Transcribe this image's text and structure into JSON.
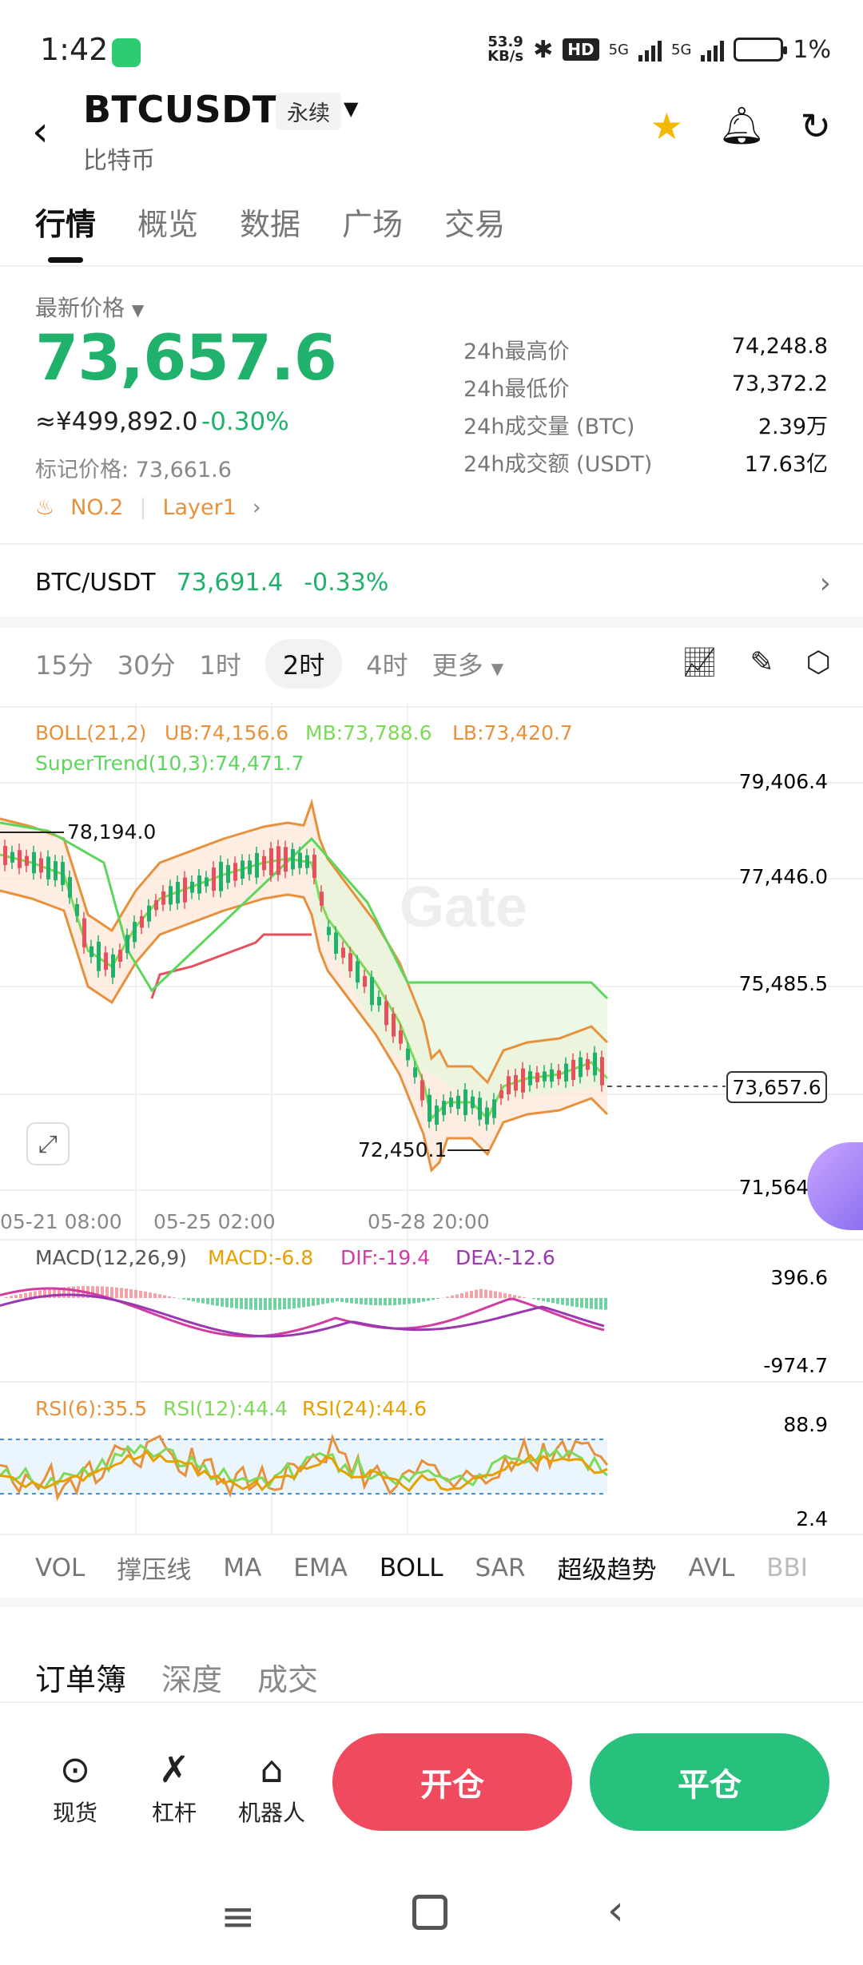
{
  "status": {
    "time": "1:42",
    "net_speed_top": "53.9",
    "net_speed_bottom": "KB/s",
    "hd": "HD",
    "net1": "5G",
    "net2": "5G",
    "battery": "1%"
  },
  "header": {
    "symbol": "BTCUSDT",
    "contract_type": "永续",
    "subtitle": "比特币"
  },
  "tabs": [
    "行情",
    "概览",
    "数据",
    "广场",
    "交易"
  ],
  "price": {
    "label": "最新价格",
    "last": "73,657.6",
    "cny": "≈¥499,892.0",
    "change": "-0.30%",
    "mark": "标记价格: 73,661.6",
    "rank": "NO.2",
    "category": "Layer1"
  },
  "stats": [
    {
      "k": "24h最高价",
      "v": "74,248.8"
    },
    {
      "k": "24h最低价",
      "v": "73,372.2"
    },
    {
      "k": "24h成交量 (BTC)",
      "v": "2.39万"
    },
    {
      "k": "24h成交额 (USDT)",
      "v": "17.63亿"
    }
  ],
  "spot_pair": {
    "name": "BTC/USDT",
    "price": "73,691.4",
    "change": "-0.33%"
  },
  "timeframes": [
    "15分",
    "30分",
    "1时",
    "2时",
    "4时",
    "更多"
  ],
  "timeframe_active": "2时",
  "chart": {
    "boll_label": "BOLL(21,2)",
    "ub": "UB:74,156.6",
    "mb": "MB:73,788.6",
    "lb": "LB:73,420.7",
    "supertrend": "SuperTrend(10,3):74,471.7",
    "y_ticks": [
      "79,406.4",
      "77,446.0",
      "75,485.5",
      "71,564.7"
    ],
    "current_price_tag": "73,657.6",
    "high_marker": "78,194.0",
    "low_marker": "72,450.1",
    "x_ticks": [
      "05-21 08:00",
      "05-25 02:00",
      "05-28 20:00"
    ],
    "watermark": "Gate",
    "macd_label": "MACD(12,26,9)",
    "macd": "MACD:-6.8",
    "dif": "DIF:-19.4",
    "dea": "DEA:-12.6",
    "macd_top": "396.6",
    "macd_bottom": "-974.7",
    "rsi6": "RSI(6):35.5",
    "rsi12": "RSI(12):44.4",
    "rsi24": "RSI(24):44.6",
    "rsi_top": "88.9",
    "rsi_bottom": "2.4",
    "colors": {
      "up": "#e8505b",
      "down": "#20b26c",
      "ub": "#e8913c",
      "mb": "#7ed957",
      "st": "#5cd65c",
      "dif": "#d23ca0",
      "dea": "#9b37b0"
    }
  },
  "indicators": [
    "VOL",
    "撑压线",
    "MA",
    "EMA",
    "BOLL",
    "SAR",
    "超级趋势",
    "AVL",
    "BBI"
  ],
  "indicator_active": "BOLL",
  "orderbook_tabs": [
    "订单簿",
    "深度",
    "成交"
  ],
  "actions": [
    {
      "icon": "spot-icon",
      "label": "现货"
    },
    {
      "icon": "leverage-icon",
      "label": "杠杆"
    },
    {
      "icon": "robot-icon",
      "label": "机器人"
    }
  ],
  "buttons": {
    "open": "开仓",
    "close": "平仓"
  }
}
